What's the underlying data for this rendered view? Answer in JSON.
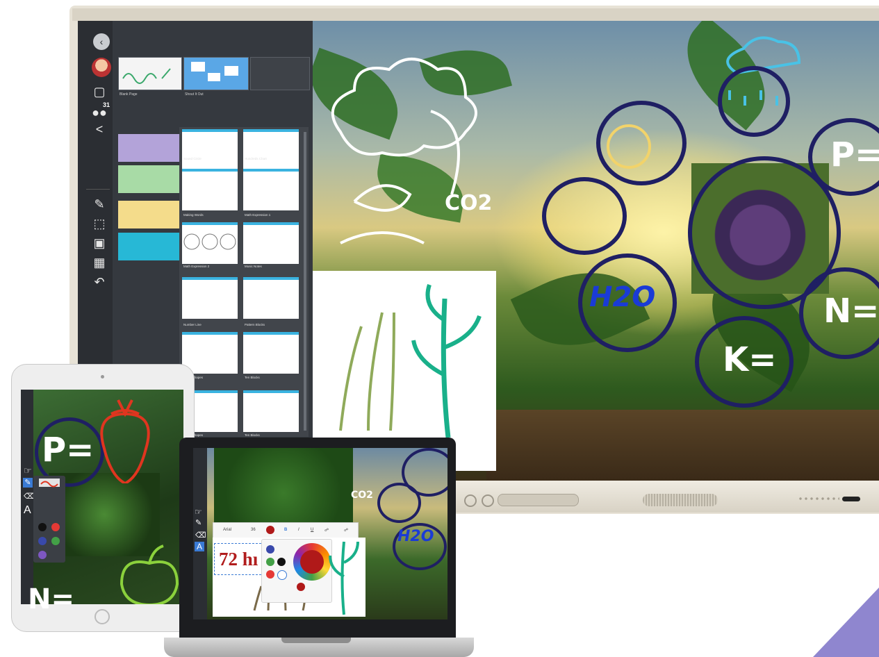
{
  "display": {
    "sidebar": {
      "badge_count": "31",
      "top_icons": [
        "back-icon",
        "avatar",
        "pages-icon",
        "participants-icon",
        "share-icon"
      ],
      "tool_icons": [
        "pen-icon",
        "select-icon",
        "widgets-icon",
        "add-image-icon",
        "undo-icon"
      ]
    },
    "pages": [
      {
        "caption": "Blank Page"
      },
      {
        "caption": "Shout It Out"
      }
    ],
    "templates": [
      {
        "label": "Sound Circle"
      },
      {
        "label": "Hundreds Chart"
      },
      {
        "label": "Making Words"
      },
      {
        "label": "Math Expression 1"
      },
      {
        "label": "Math Expression 2"
      },
      {
        "label": "Music Notes"
      },
      {
        "label": "Number Line"
      },
      {
        "label": "Pattern Blocks"
      },
      {
        "label": "Bingo Shapes"
      },
      {
        "label": "Ten Blocks"
      },
      {
        "label": "Bingo Shapes"
      },
      {
        "label": "Ten Blocks"
      }
    ],
    "canvas": {
      "annotations": {
        "p": "P=",
        "h2o": "H2O",
        "k": "K=",
        "n": "N=",
        "co2": "CO2"
      }
    }
  },
  "tablet": {
    "annotation_p": "P=",
    "annotation_n": "N="
  },
  "laptop": {
    "toolbar": {
      "font": "Arial",
      "size": "36",
      "bold": "B",
      "italic": "I",
      "underline": "U"
    },
    "typed_text": "72 hı",
    "annotation_h2o": "H2O",
    "annotation_co2": "CO2"
  },
  "colors": {
    "accent_blue": "#3ab3e0",
    "annotation_navy": "#1f1f63",
    "annotation_blue": "#1a3bd6",
    "annotation_teal": "#19b08a",
    "annotation_red": "#e0351f",
    "corner_purple": "#8f86cf"
  }
}
